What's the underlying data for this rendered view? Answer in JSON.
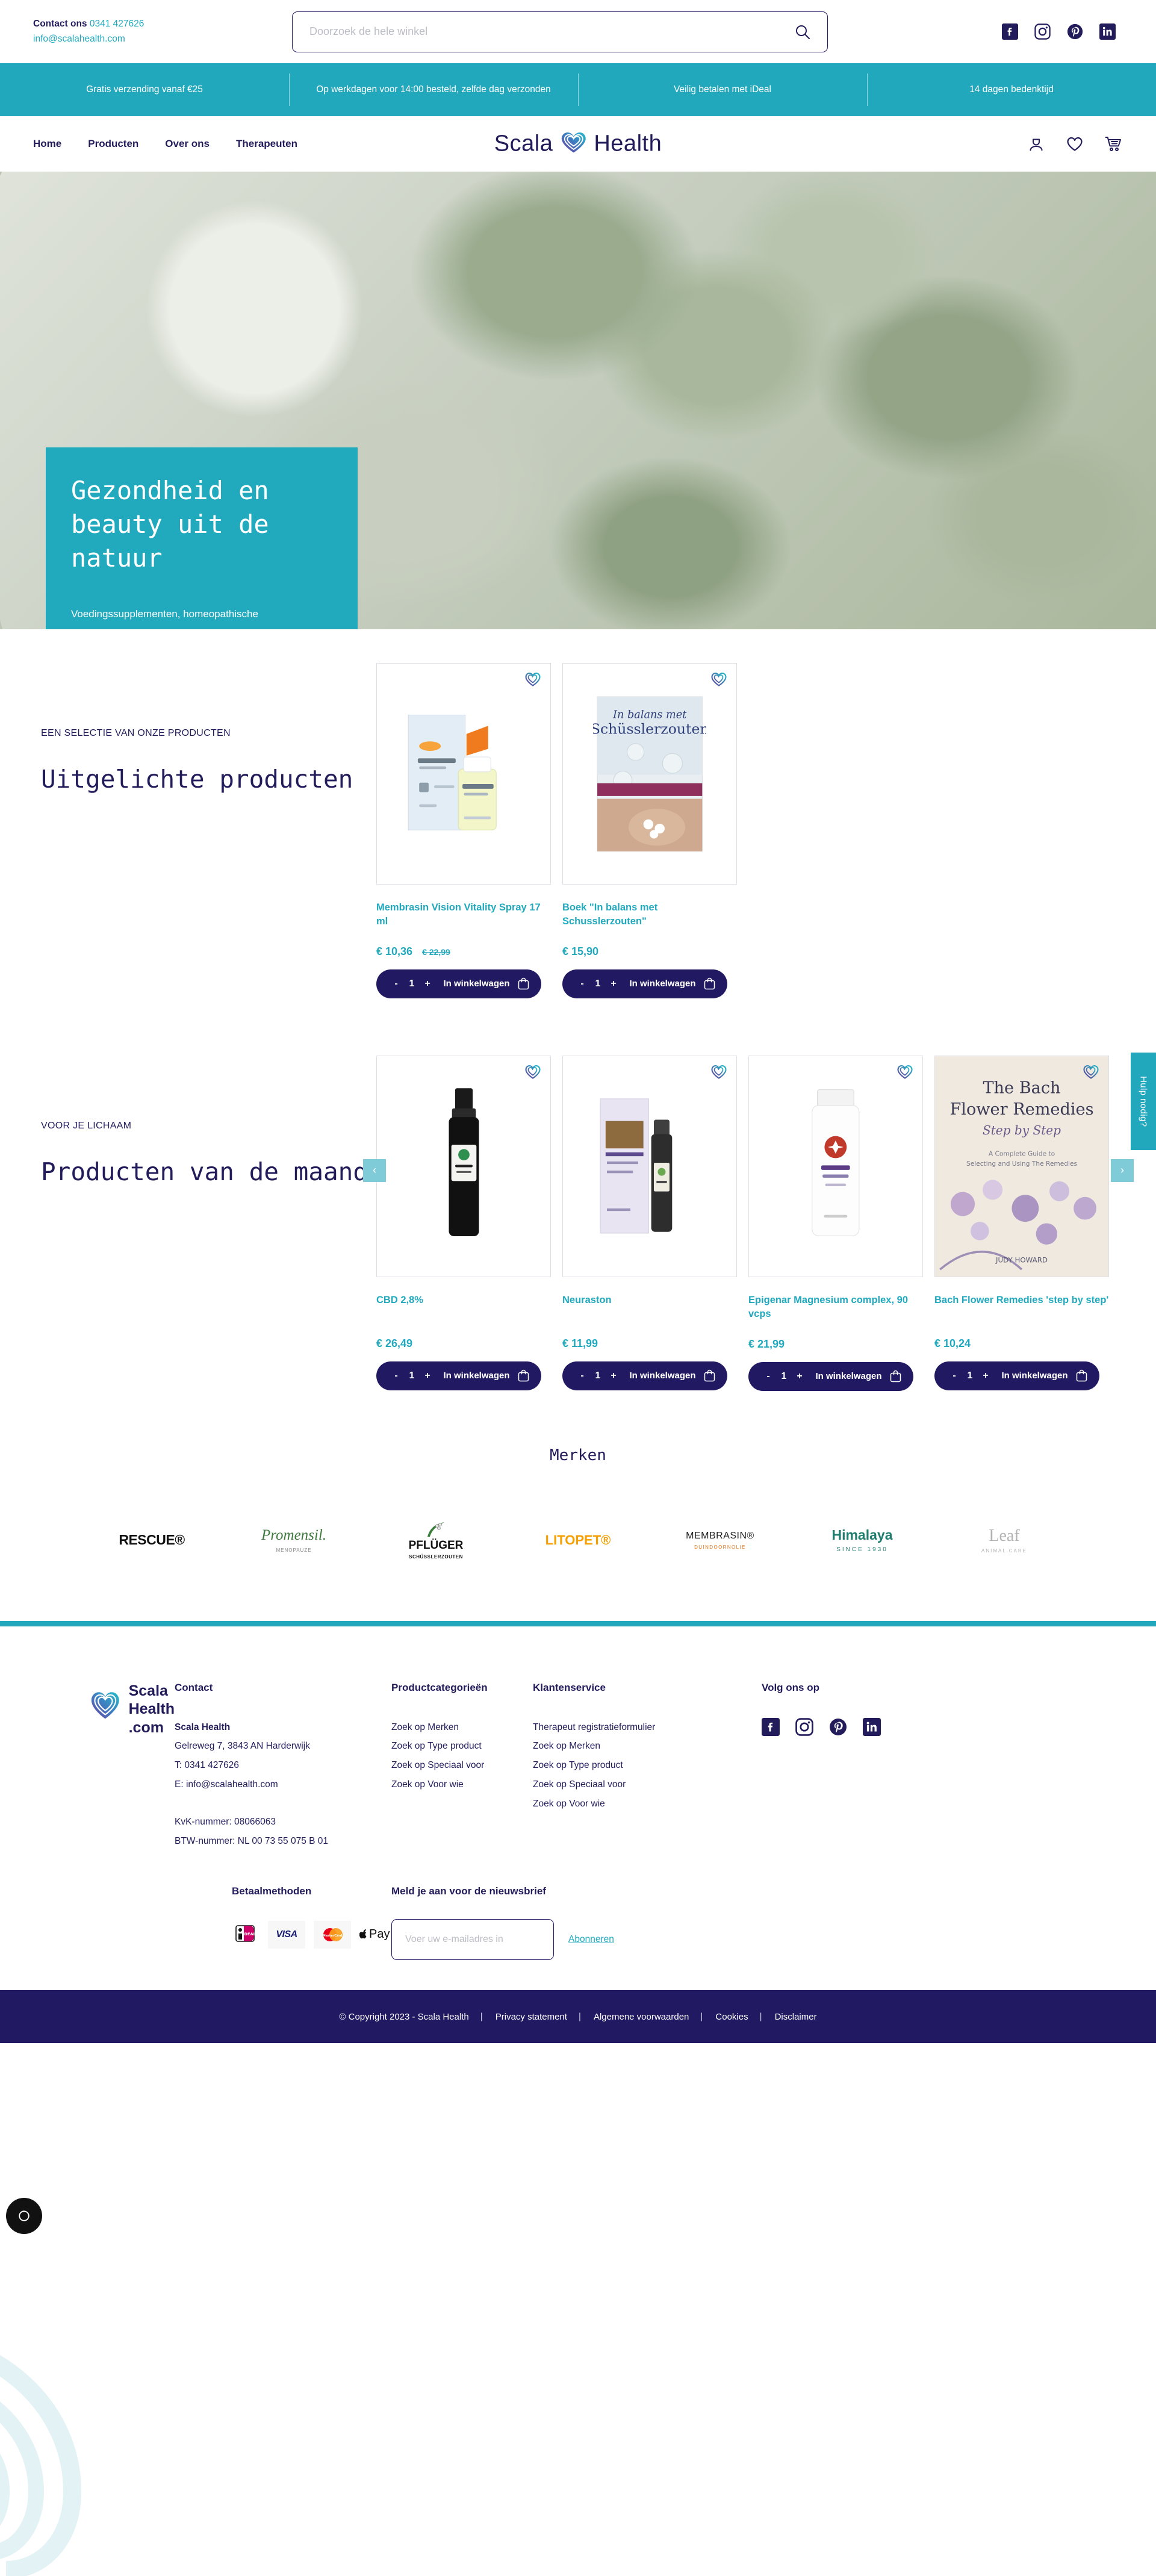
{
  "topbar": {
    "contact_label": "Contact ons",
    "phone": "0341 427626",
    "email": "info@scalahealth.com",
    "search_placeholder": "Doorzoek de hele winkel",
    "search_value": "",
    "social": [
      "facebook-icon",
      "instagram-icon",
      "pinterest-icon",
      "linkedin-icon"
    ]
  },
  "usp": [
    "Gratis verzending vanaf €25",
    "Op werkdagen voor 14:00 besteld, zelfde dag verzonden",
    "Veilig betalen met iDeal",
    "14 dagen bedenktijd"
  ],
  "nav": {
    "links": [
      "Home",
      "Producten",
      "Over ons",
      "Therapeuten"
    ],
    "brand": "Scala  Health",
    "brand_left": "Scala",
    "brand_right": "Health",
    "icons": [
      "account-icon",
      "wishlist-icon",
      "cart-icon"
    ]
  },
  "hero": {
    "title": "Gezondheid en beauty uit de natuur",
    "text": "Voedingssupplementen, homeopathische geneesmiddelen en natuurlijke huidverzorgingsproducten voor het hele gezin."
  },
  "featured": {
    "kicker": "EEN SELECTIE VAN ONZE PRODUCTEN",
    "title": "Uitgelichte producten",
    "products": [
      {
        "name": "Membrasin Vision Vitality Spray 17 ml",
        "price": "€ 10,36",
        "old_price": "€ 22,99",
        "qty": "1",
        "button": "In winkelwagen",
        "minus": "-",
        "plus": "+"
      },
      {
        "name": "Boek \"In balans met Schusslerzouten\"",
        "price": "€ 15,90",
        "old_price": "",
        "qty": "1",
        "button": "In winkelwagen",
        "minus": "-",
        "plus": "+"
      }
    ]
  },
  "monthly": {
    "kicker": "VOOR JE LICHAAM",
    "title": "Producten van de maand",
    "prev": "‹",
    "next": "›",
    "products": [
      {
        "name": "CBD 2,8%",
        "price": "€ 26,49",
        "old_price": "",
        "qty": "1",
        "button": "In winkelwagen",
        "minus": "-",
        "plus": "+"
      },
      {
        "name": "Neuraston",
        "price": "€ 11,99",
        "old_price": "",
        "qty": "1",
        "button": "In winkelwagen",
        "minus": "-",
        "plus": "+"
      },
      {
        "name": "Epigenar Magnesium complex, 90 vcps",
        "price": "€ 21,99",
        "old_price": "",
        "qty": "1",
        "button": "In winkelwagen",
        "minus": "-",
        "plus": "+"
      },
      {
        "name": "Bach Flower Remedies 'step by step'",
        "price": "€ 10,24",
        "old_price": "",
        "qty": "1",
        "button": "In winkelwagen",
        "minus": "-",
        "plus": "+"
      }
    ]
  },
  "help_tab": "Hulp nodig?",
  "brands": {
    "title": "Merken",
    "items": [
      {
        "name": "RESCUE®",
        "sub": ""
      },
      {
        "name": "Promensil.",
        "sub": "MENOPAUZE"
      },
      {
        "name": "PFLÜGER",
        "sub": "SCHÜSSLERZOUTEN"
      },
      {
        "name": "LITOPET®",
        "sub": ""
      },
      {
        "name": "MEMBRASIN®",
        "sub": "DUINDOORNOLIE"
      },
      {
        "name": "Himalaya",
        "sub": "SINCE 1930"
      },
      {
        "name": "Leaf",
        "sub": "ANIMAL CARE"
      }
    ]
  },
  "footer": {
    "logo_text": "Scala Health .com",
    "logo_line1": "Scala",
    "logo_line2": "Health",
    "logo_line3": ".com",
    "contact": {
      "heading": "Contact",
      "company": "Scala Health",
      "address": "Gelreweg 7, 3843 AN Harderwijk",
      "phone": "T: 0341 427626",
      "email": "E: info@scalahealth.com",
      "kvk": "KvK-nummer: 08066063",
      "btw": "BTW-nummer: NL 00 73 55 075 B 01"
    },
    "categories": {
      "heading": "Productcategorieën",
      "items": [
        "Zoek op Merken",
        "Zoek op Type product",
        "Zoek op Speciaal voor",
        "Zoek op Voor wie"
      ]
    },
    "service": {
      "heading": "Klantenservice",
      "items": [
        "Therapeut registratieformulier",
        "Zoek op Merken",
        "Zoek op Type product",
        "Zoek op Speciaal voor",
        "Zoek op Voor wie"
      ]
    },
    "follow": {
      "heading": "Volg ons op",
      "social": [
        "facebook-icon",
        "instagram-icon",
        "pinterest-icon",
        "linkedin-icon"
      ]
    },
    "payment": {
      "heading": "Betaalmethoden",
      "methods": [
        "iDEAL",
        "VISA",
        "MasterCard",
        "Apple Pay"
      ]
    },
    "newsletter": {
      "heading": "Meld je aan voor de nieuwsbrief",
      "placeholder": "Voer uw e-mailadres in",
      "value": "",
      "submit": "Abonneren"
    }
  },
  "copyright": {
    "items": [
      "© Copyright 2023 - Scala Health",
      "Privacy statement",
      "Algemene voorwaarden",
      "Cookies",
      "Disclaimer"
    ]
  },
  "cookie_widget": "cookie-settings-icon",
  "colors": {
    "teal": "#22A8BC",
    "navy": "#211A63",
    "light_teal": "#7FCBD8"
  }
}
